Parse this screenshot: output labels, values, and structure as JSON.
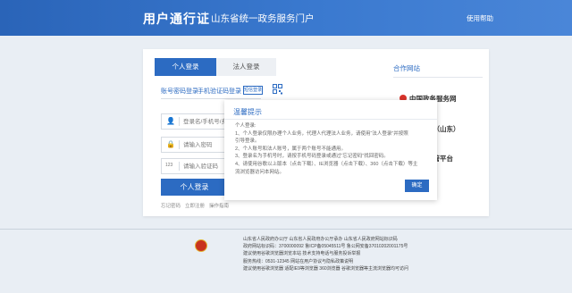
{
  "header": {
    "title": "用户通行证",
    "subtitle": "山东省统一政务服务门户",
    "help": "使用帮助"
  },
  "tabs": [
    {
      "label": "个人登录"
    },
    {
      "label": "法人登录"
    }
  ],
  "login_methods": {
    "password": "账号密码登录",
    "sms": "手机验证码登录",
    "badge": "短信登录"
  },
  "form": {
    "username_placeholder": "登录名/手机号/身",
    "password_placeholder": "请输入密码",
    "code_placeholder": "请输入验证码",
    "code_icon": "123",
    "submit_label": "个人登录"
  },
  "bottom_links": [
    "忘记密码",
    "立即注册",
    "操作指南"
  ],
  "right_panel": {
    "title": "合作网站",
    "items": [
      "中国政务服务网",
      "中国政府网（山东）",
      "国家审批监管平台"
    ]
  },
  "modal": {
    "title": "温馨提示",
    "lines": [
      "个人登录:",
      "1、个人登录仅限办理个人业务，代理人代理法人业务，请使用“法人登录”并按照",
      "引导登录。",
      "2、个人账号和法人账号，属于两个账号不能通用。",
      "3、登录名为手机号时，请按手机号码登录或通过“忘记密码”找回密码。",
      "4、请使用谷歌以上版本（点击下载）、IE浏览器（点击下载）、360（点击下载）等主",
      "流浏览器访问本网站。"
    ],
    "confirm_label": "确定"
  },
  "footer": {
    "lines": [
      "山东省人民政府办公厅    山东省人民政府办公厅承办    山东省人民政府网站标识码",
      "政府网站标识码：3700000092    鲁ICP备05045511号    鲁公网安备37010202001175号",
      "建议使用谷歌浏览器浏览本站    技术支持电话与服务投诉举报",
      "服务热线：0531-12345    网站在用户协议与隐私政策说明",
      "建议使用谷歌浏览器    适配IE9等浏览器    360浏览器    谷歌浏览器等主流浏览器均可访问"
    ]
  },
  "colors": {
    "brand": "#2c6bc2",
    "header_bg": "#3a79cf",
    "page_bg": "#e9eef4",
    "accent_red": "#d9342b"
  }
}
